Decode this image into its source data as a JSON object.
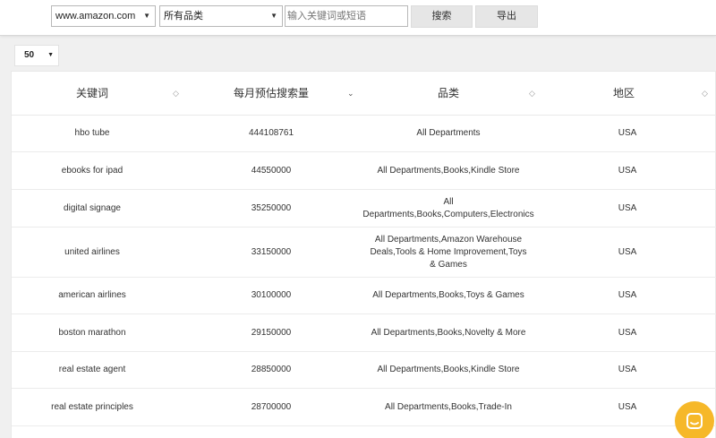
{
  "toolbar": {
    "site_select": "www.amazon.com",
    "category_select": "所有品类",
    "search_placeholder": "输入关键词或短语",
    "search_button": "搜索",
    "export_button": "导出"
  },
  "pagesize": "50",
  "table": {
    "headers": [
      "关键词",
      "每月预估搜索量",
      "品类",
      "地区"
    ],
    "rows": [
      {
        "keyword": "hbo tube",
        "volume": "444108761",
        "category": "All Departments",
        "region": "USA"
      },
      {
        "keyword": "ebooks for ipad",
        "volume": "44550000",
        "category": "All Departments,Books,Kindle Store",
        "region": "USA"
      },
      {
        "keyword": "digital signage",
        "volume": "35250000",
        "category": "All Departments,Books,Computers,Electronics",
        "region": "USA"
      },
      {
        "keyword": "united airlines",
        "volume": "33150000",
        "category": "All Departments,Amazon Warehouse Deals,Tools & Home Improvement,Toys & Games",
        "region": "USA"
      },
      {
        "keyword": "american airlines",
        "volume": "30100000",
        "category": "All Departments,Books,Toys & Games",
        "region": "USA"
      },
      {
        "keyword": "boston marathon",
        "volume": "29150000",
        "category": "All Departments,Books,Novelty & More",
        "region": "USA"
      },
      {
        "keyword": "real estate agent",
        "volume": "28850000",
        "category": "All Departments,Books,Kindle Store",
        "region": "USA"
      },
      {
        "keyword": "real estate principles",
        "volume": "28700000",
        "category": "All Departments,Books,Trade-In",
        "region": "USA"
      }
    ]
  },
  "colors": {
    "chat_button": "#f6b829"
  }
}
